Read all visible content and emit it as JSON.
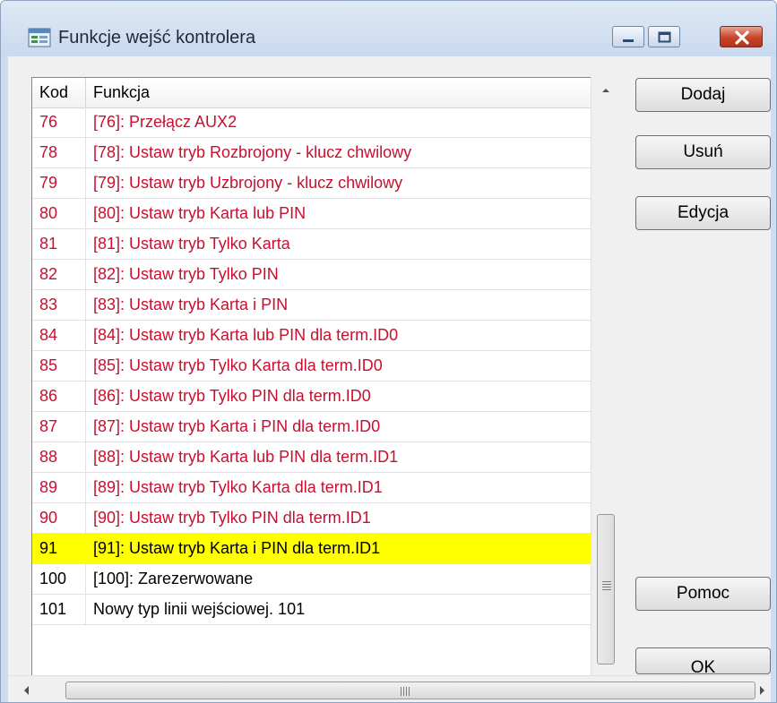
{
  "window": {
    "title": "Funkcje wejść kontrolera"
  },
  "table": {
    "columns": [
      "Kod",
      "Funkcja"
    ],
    "rows": [
      {
        "kod": "76",
        "funkcja": "[76]: Przełącz AUX2",
        "color": "#c8102e"
      },
      {
        "kod": "78",
        "funkcja": "[78]: Ustaw tryb Rozbrojony - klucz chwilowy",
        "color": "#c8102e"
      },
      {
        "kod": "79",
        "funkcja": "[79]: Ustaw tryb Uzbrojony - klucz chwilowy",
        "color": "#c8102e"
      },
      {
        "kod": "80",
        "funkcja": "[80]: Ustaw tryb Karta lub PIN",
        "color": "#c8102e"
      },
      {
        "kod": "81",
        "funkcja": "[81]: Ustaw tryb Tylko Karta",
        "color": "#c8102e"
      },
      {
        "kod": "82",
        "funkcja": "[82]: Ustaw tryb Tylko PIN",
        "color": "#c8102e"
      },
      {
        "kod": "83",
        "funkcja": "[83]: Ustaw tryb Karta i PIN",
        "color": "#c8102e"
      },
      {
        "kod": "84",
        "funkcja": "[84]: Ustaw tryb Karta lub PIN dla term.ID0",
        "color": "#c8102e"
      },
      {
        "kod": "85",
        "funkcja": "[85]: Ustaw tryb Tylko Karta dla term.ID0",
        "color": "#c8102e"
      },
      {
        "kod": "86",
        "funkcja": "[86]: Ustaw tryb Tylko PIN dla term.ID0",
        "color": "#c8102e"
      },
      {
        "kod": "87",
        "funkcja": "[87]: Ustaw tryb Karta i PIN dla term.ID0",
        "color": "#c8102e"
      },
      {
        "kod": "88",
        "funkcja": "[88]: Ustaw tryb Karta lub PIN dla term.ID1",
        "color": "#c8102e"
      },
      {
        "kod": "89",
        "funkcja": "[89]: Ustaw tryb Tylko Karta dla term.ID1",
        "color": "#c8102e"
      },
      {
        "kod": "90",
        "funkcja": "[90]: Ustaw tryb Tylko PIN dla term.ID1",
        "color": "#c8102e"
      },
      {
        "kod": "91",
        "funkcja": "[91]: Ustaw tryb Karta i PIN dla term.ID1",
        "color": "#000000",
        "selected": true
      },
      {
        "kod": "100",
        "funkcja": "[100]: Zarezerwowane",
        "color": "#000000"
      },
      {
        "kod": "101",
        "funkcja": "Nowy typ linii wejściowej. 101",
        "color": "#000000"
      }
    ]
  },
  "buttons": {
    "add": "Dodaj",
    "remove": "Usuń",
    "edit": "Edycja",
    "help": "Pomoc",
    "ok": "OK"
  },
  "colors": {
    "highlight": "#ffff00",
    "red_text": "#c8102e"
  },
  "icons": {
    "app": "window-list-icon",
    "minimize": "minimize-icon",
    "maximize": "maximize-icon",
    "close": "close-icon"
  }
}
